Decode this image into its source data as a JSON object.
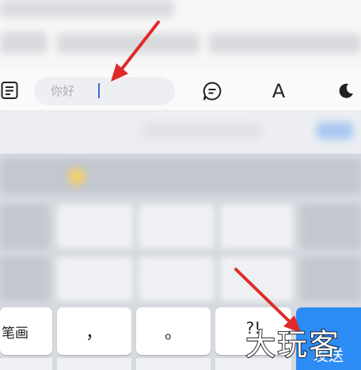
{
  "chat": {},
  "toolbar": {
    "list_icon": "list-icon",
    "message_icon": "message-icon",
    "font_icon": "font-icon",
    "font_glyph": "A",
    "night_icon": "moon-icon"
  },
  "input": {
    "value": "你好"
  },
  "keyboard": {
    "stroke_key_label": "笔画",
    "comma_key": "，",
    "period_key": "。",
    "question_key": "?!",
    "send_label": "发送"
  },
  "watermark": {
    "text": "大玩客"
  },
  "colors": {
    "send_blue": "#2b8cf6",
    "caret_blue": "#3b6bd9",
    "arrow_red": "#e02a2a"
  }
}
